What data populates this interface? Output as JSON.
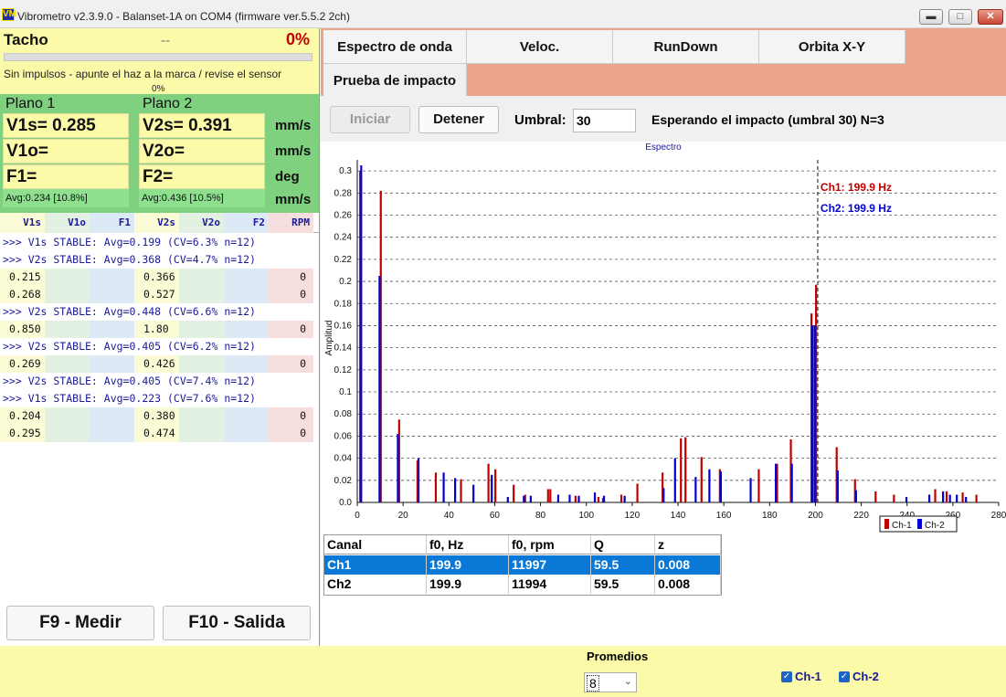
{
  "window": {
    "title": "Vibrometro v2.3.9.0 - Balanset-1A on COM4 (firmware ver.5.5.2 2ch)",
    "app_icon": "VM",
    "minimize": "▬",
    "maximize": "□",
    "close": "✕"
  },
  "tacho": {
    "label": "Tacho",
    "value": "--",
    "percent": "0%",
    "progress": 0,
    "message": "Sin impulsos - apunte el haz a la marca / revise el sensor",
    "progress_text": "0%"
  },
  "planes": [
    {
      "title": "Plano 1",
      "v_s": "V1s= 0.285",
      "v_o": "V1o=",
      "f": "F1=",
      "avg": "Avg:0.234 [10.8%]"
    },
    {
      "title": "Plano 2",
      "v_s": "V2s= 0.391",
      "v_o": "V2o=",
      "f": "F2=",
      "avg": "Avg:0.436 [10.5%]"
    }
  ],
  "units": [
    "mm/s",
    "mm/s",
    "deg",
    "mm/s"
  ],
  "columns": [
    "V1s",
    "V1o",
    "F1",
    "V2s",
    "V2o",
    "F2",
    "RPM"
  ],
  "log": [
    {
      "type": "line",
      "text": ">>> V1s STABLE: Avg=0.199 (CV=6.3% n=12)"
    },
    {
      "type": "line",
      "text": ">>> V2s STABLE: Avg=0.368 (CV=4.7% n=12)"
    },
    {
      "type": "row",
      "v1s": "0.215",
      "v2s": "0.366",
      "rpm": "0"
    },
    {
      "type": "row",
      "v1s": "0.268",
      "v2s": "0.527",
      "rpm": "0"
    },
    {
      "type": "line",
      "text": ">>> V2s STABLE: Avg=0.448 (CV=6.6% n=12)"
    },
    {
      "type": "row",
      "v1s": "0.850",
      "v2s": "1.80",
      "rpm": "0"
    },
    {
      "type": "line",
      "text": ">>> V2s STABLE: Avg=0.405 (CV=6.2% n=12)"
    },
    {
      "type": "row",
      "v1s": "0.269",
      "v2s": "0.426",
      "rpm": "0"
    },
    {
      "type": "line",
      "text": ">>> V2s STABLE: Avg=0.405 (CV=7.4% n=12)"
    },
    {
      "type": "line",
      "text": ">>> V1s STABLE: Avg=0.223 (CV=7.6% n=12)"
    },
    {
      "type": "row",
      "v1s": "0.204",
      "v2s": "0.380",
      "rpm": "0"
    },
    {
      "type": "row",
      "v1s": "0.295",
      "v2s": "0.474",
      "rpm": "0"
    }
  ],
  "buttons": {
    "measure": "F9 - Medir",
    "exit": "F10 - Salida",
    "start": "Iniciar",
    "stop": "Detener"
  },
  "tabs": {
    "wave": "Espectro de onda",
    "veloc": "Veloc.",
    "rundown": "RunDown",
    "orbit": "Orbita X-Y",
    "impact": "Prueba de impacto"
  },
  "toolbar": {
    "threshold_label": "Umbral:",
    "threshold_value": "30",
    "status": "Esperando el impacto (umbral 30)  N=3"
  },
  "chart_data": {
    "type": "bar",
    "title": "Espectro",
    "ylabel": "Amplitud",
    "xlim": [
      0,
      280
    ],
    "ylim": [
      0,
      0.31
    ],
    "yticks": [
      0.0,
      0.02,
      0.04,
      0.06,
      0.08,
      0.1,
      0.12,
      0.14,
      0.16,
      0.18,
      0.2,
      0.22,
      0.24,
      0.26,
      0.28,
      0.3
    ],
    "xticks": [
      0,
      20,
      40,
      60,
      80,
      100,
      120,
      140,
      160,
      180,
      200,
      220,
      240,
      260,
      280
    ],
    "grid": true,
    "legend": "bottom-right",
    "marker_x": 201,
    "annotations": [
      "Ch1: 199.9 Hz",
      "Ch2: 199.9 Hz"
    ],
    "colors": {
      "ch1": "#c00000",
      "ch2": "#0000d0"
    },
    "series": [
      {
        "name": "Ch-1",
        "x": [
          1,
          10,
          18,
          26,
          34,
          45,
          57,
          60,
          68,
          73,
          83,
          84,
          95,
          105,
          107,
          115,
          122,
          133,
          141,
          143,
          150,
          158,
          175,
          183,
          189,
          198,
          200,
          209,
          217,
          226,
          234,
          252,
          257,
          264,
          270
        ],
        "y": [
          0.3,
          0.282,
          0.075,
          0.038,
          0.027,
          0.021,
          0.035,
          0.03,
          0.016,
          0.007,
          0.012,
          0.012,
          0.006,
          0.005,
          0.004,
          0.007,
          0.017,
          0.027,
          0.058,
          0.059,
          0.041,
          0.03,
          0.03,
          0.035,
          0.057,
          0.171,
          0.197,
          0.05,
          0.021,
          0.01,
          0.007,
          0.012,
          0.01,
          0.009,
          0.007
        ]
      },
      {
        "name": "Ch-2",
        "x": [
          2,
          10,
          18,
          27,
          38,
          43,
          51,
          59,
          66,
          73,
          76,
          88,
          93,
          97,
          104,
          108,
          117,
          134,
          139,
          148,
          154,
          159,
          172,
          183,
          190,
          199,
          200,
          210,
          218,
          240,
          250,
          256,
          259,
          262,
          266
        ],
        "y": [
          0.305,
          0.205,
          0.062,
          0.04,
          0.027,
          0.022,
          0.016,
          0.025,
          0.005,
          0.006,
          0.006,
          0.007,
          0.007,
          0.006,
          0.009,
          0.006,
          0.006,
          0.013,
          0.04,
          0.023,
          0.03,
          0.028,
          0.022,
          0.035,
          0.035,
          0.16,
          0.16,
          0.029,
          0.011,
          0.005,
          0.007,
          0.01,
          0.007,
          0.007,
          0.005
        ]
      }
    ]
  },
  "result_table": {
    "headers": [
      "Canal",
      "f0, Hz",
      "f0, rpm",
      "Q",
      "z"
    ],
    "rows": [
      [
        "Ch1",
        "199.9",
        "11997",
        "59.5",
        "0.008"
      ],
      [
        "Ch2",
        "199.9",
        "11994",
        "59.5",
        "0.008"
      ]
    ]
  },
  "bottom": {
    "averages_label": "Promedios",
    "averages_value": "8",
    "ch1_label": "Ch-1",
    "ch2_label": "Ch-2"
  }
}
